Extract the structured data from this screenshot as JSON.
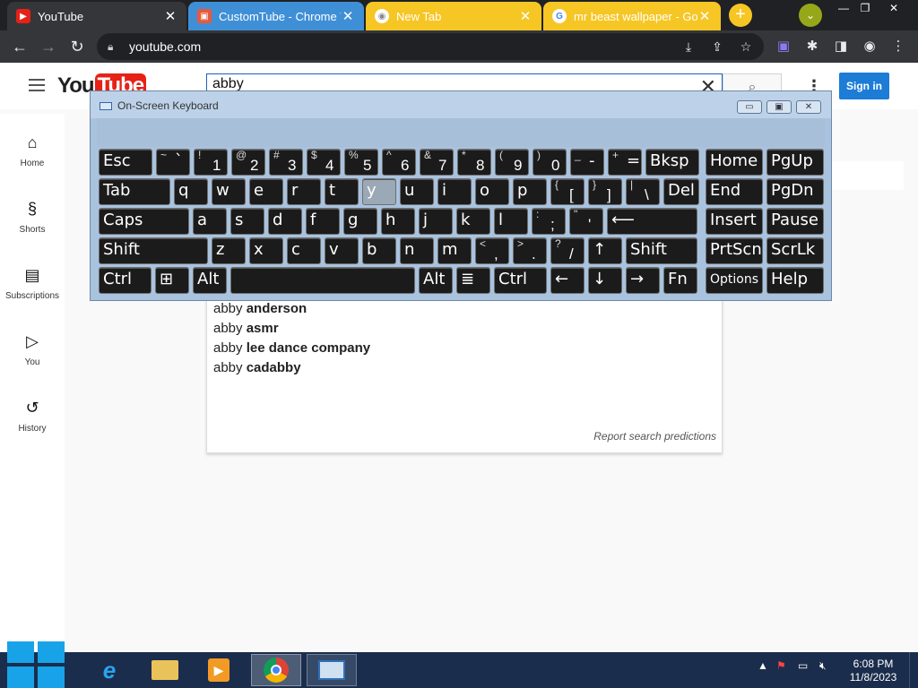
{
  "browser": {
    "tabs": [
      {
        "title": "YouTube",
        "favicon": "youtube-icon"
      },
      {
        "title": "CustomTube - Chrome W",
        "favicon": "customtube-icon"
      },
      {
        "title": "New Tab",
        "favicon": "chrome-icon"
      },
      {
        "title": "mr beast wallpaper - Goo",
        "favicon": "google-icon"
      }
    ],
    "url": "youtube.com",
    "new_tab_label": "+",
    "colors": {
      "tab_group_blue": "#3f8fd7",
      "tab_group_yellow": "#f6c624",
      "chrome_dark": "#202124"
    }
  },
  "youtube": {
    "logo_you": "You",
    "logo_tube": "Tube",
    "search_value": "abby",
    "signin_label": "Sign in",
    "sidebar": [
      {
        "label": "Home",
        "icon": "home-icon"
      },
      {
        "label": "Shorts",
        "icon": "shorts-icon"
      },
      {
        "label": "Subscriptions",
        "icon": "subscriptions-icon"
      },
      {
        "label": "You",
        "icon": "you-icon"
      },
      {
        "label": "History",
        "icon": "history-icon"
      }
    ],
    "suggestions": [
      {
        "prefix": "abby",
        "rest": "anderson"
      },
      {
        "prefix": "abby",
        "rest": "asmr"
      },
      {
        "prefix": "abby",
        "rest": "lee dance company"
      },
      {
        "prefix": "abby",
        "rest": "cadabby"
      }
    ],
    "report_label": "Report search predictions"
  },
  "osk": {
    "title": "On-Screen Keyboard",
    "rows": [
      [
        {
          "m": "Esc"
        },
        {
          "t": "~",
          "m": "`"
        },
        {
          "t": "!",
          "b": "1"
        },
        {
          "t": "@",
          "b": "2"
        },
        {
          "t": "#",
          "b": "3"
        },
        {
          "t": "$",
          "b": "4"
        },
        {
          "t": "%",
          "b": "5"
        },
        {
          "t": "^",
          "b": "6"
        },
        {
          "t": "&",
          "b": "7"
        },
        {
          "t": "*",
          "b": "8"
        },
        {
          "t": "(",
          "b": "9"
        },
        {
          "t": ")",
          "b": "0"
        },
        {
          "t": "_",
          "m": "-"
        },
        {
          "t": "+",
          "m": "="
        },
        {
          "m": "Bksp"
        }
      ],
      [
        {
          "m": "Tab"
        },
        {
          "m": "q"
        },
        {
          "m": "w"
        },
        {
          "m": "e"
        },
        {
          "m": "r"
        },
        {
          "m": "t"
        },
        {
          "m": "y"
        },
        {
          "m": "u"
        },
        {
          "m": "i"
        },
        {
          "m": "o"
        },
        {
          "m": "p"
        },
        {
          "t": "{",
          "b": "["
        },
        {
          "t": "}",
          "b": "]"
        },
        {
          "t": "|",
          "b": "\\"
        },
        {
          "m": "Del"
        }
      ],
      [
        {
          "m": "Caps"
        },
        {
          "m": "a"
        },
        {
          "m": "s"
        },
        {
          "m": "d"
        },
        {
          "m": "f"
        },
        {
          "m": "g"
        },
        {
          "m": "h"
        },
        {
          "m": "j"
        },
        {
          "m": "k"
        },
        {
          "m": "l"
        },
        {
          "t": ":",
          "b": ";"
        },
        {
          "t": "\"",
          "b": "'"
        },
        {
          "m": "⟵"
        }
      ],
      [
        {
          "m": "Shift"
        },
        {
          "m": "z"
        },
        {
          "m": "x"
        },
        {
          "m": "c"
        },
        {
          "m": "v"
        },
        {
          "m": "b"
        },
        {
          "m": "n"
        },
        {
          "m": "m"
        },
        {
          "t": "<",
          "b": ","
        },
        {
          "t": ">",
          "b": "."
        },
        {
          "t": "?",
          "b": "/"
        },
        {
          "m": "↑"
        },
        {
          "m": "Shift"
        }
      ],
      [
        {
          "m": "Ctrl"
        },
        {
          "m": "⊞"
        },
        {
          "m": "Alt"
        },
        {
          "m": ""
        },
        {
          "m": "Alt"
        },
        {
          "m": "≣"
        },
        {
          "m": "Ctrl"
        },
        {
          "m": "←"
        },
        {
          "m": "↓"
        },
        {
          "m": "→"
        },
        {
          "m": "Fn"
        }
      ]
    ],
    "side_rows": [
      [
        "Home",
        "PgUp"
      ],
      [
        "End",
        "PgDn"
      ],
      [
        "Insert",
        "Pause"
      ],
      [
        "PrtScn",
        "ScrLk"
      ],
      [
        "Options",
        "Help"
      ]
    ],
    "highlighted_key": "y"
  },
  "taskbar": {
    "time": "6:08 PM",
    "date": "11/8/2023",
    "apps": [
      "internet-explorer-icon",
      "file-explorer-icon",
      "media-player-icon",
      "chrome-icon",
      "on-screen-keyboard-icon"
    ]
  }
}
